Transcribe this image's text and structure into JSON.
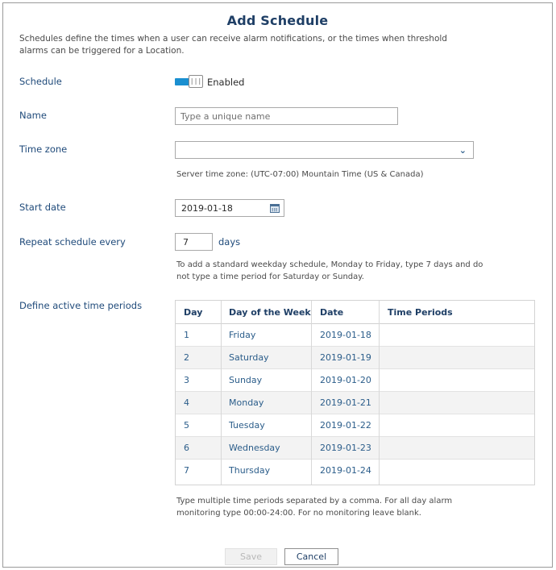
{
  "dialog": {
    "title": "Add Schedule",
    "description": "Schedules define the times when a user can receive alarm notifications, or the times when threshold alarms can be triggered for a Location."
  },
  "form": {
    "schedule_label": "Schedule",
    "schedule_toggle_state": "Enabled",
    "name_label": "Name",
    "name_value": "",
    "name_placeholder": "Type a unique name",
    "timezone_label": "Time zone",
    "timezone_value": "",
    "server_timezone_hint": "Server time zone: (UTC-07:00) Mountain Time (US & Canada)",
    "start_date_label": "Start date",
    "start_date_value": "2019-01-18",
    "repeat_label": "Repeat schedule every",
    "repeat_value": "7",
    "repeat_unit": "days",
    "repeat_hint_line1": "To add a standard weekday schedule, Monday to Friday, type 7 days and do",
    "repeat_hint_line2": "not type a time period for Saturday or Sunday.",
    "periods_label": "Define active time periods",
    "periods_hint_line1": "Type multiple time periods separated by a comma. For all day alarm",
    "periods_hint_line2": "monitoring type 00:00-24:00. For no monitoring leave blank."
  },
  "table": {
    "headers": [
      "Day",
      "Day of the Week",
      "Date",
      "Time Periods"
    ],
    "rows": [
      {
        "day": "1",
        "weekday": "Friday",
        "date": "2019-01-18",
        "periods": ""
      },
      {
        "day": "2",
        "weekday": "Saturday",
        "date": "2019-01-19",
        "periods": ""
      },
      {
        "day": "3",
        "weekday": "Sunday",
        "date": "2019-01-20",
        "periods": ""
      },
      {
        "day": "4",
        "weekday": "Monday",
        "date": "2019-01-21",
        "periods": ""
      },
      {
        "day": "5",
        "weekday": "Tuesday",
        "date": "2019-01-22",
        "periods": ""
      },
      {
        "day": "6",
        "weekday": "Wednesday",
        "date": "2019-01-23",
        "periods": ""
      },
      {
        "day": "7",
        "weekday": "Thursday",
        "date": "2019-01-24",
        "periods": ""
      }
    ]
  },
  "buttons": {
    "save": "Save",
    "cancel": "Cancel"
  },
  "icons": {
    "toggle_knob": "toggle-grip-icon",
    "select_arrow": "chevron-down-icon",
    "calendar": "calendar-icon"
  },
  "colors": {
    "accent": "#1a8fd0",
    "title": "#1f3f66",
    "label": "#1f4a7a"
  }
}
